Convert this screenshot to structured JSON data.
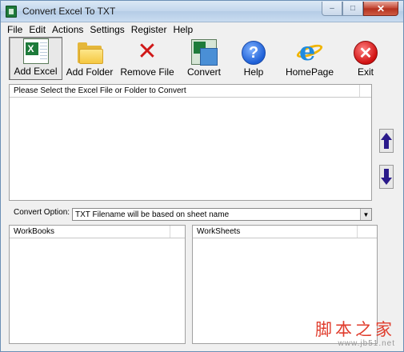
{
  "window": {
    "title": "Convert Excel To TXT"
  },
  "menu": [
    "File",
    "Edit",
    "Actions",
    "Settings",
    "Register",
    "Help"
  ],
  "toolbar": {
    "add_excel": "Add Excel",
    "add_folder": "Add Folder",
    "remove_file": "Remove File",
    "convert": "Convert",
    "help": "Help",
    "homepage": "HomePage",
    "exit": "Exit"
  },
  "file_list": {
    "header": "Please Select the Excel File or Folder to Convert"
  },
  "convert_option": {
    "label": "Convert Option:",
    "value": "TXT Filename will be based on sheet name"
  },
  "workbooks": {
    "header": "WorkBooks"
  },
  "worksheets": {
    "header": "WorkSheets"
  },
  "watermark": {
    "chinese": "脚本之家",
    "url": "www.jb51.net"
  },
  "icons": {
    "add_excel": "excel-file-icon",
    "add_folder": "folder-icon",
    "remove_file": "red-x-icon",
    "convert": "excel-convert-icon",
    "help": "help-question-icon",
    "homepage": "internet-explorer-icon",
    "exit": "exit-x-icon",
    "move_up": "arrow-up-icon",
    "move_down": "arrow-down-icon"
  }
}
